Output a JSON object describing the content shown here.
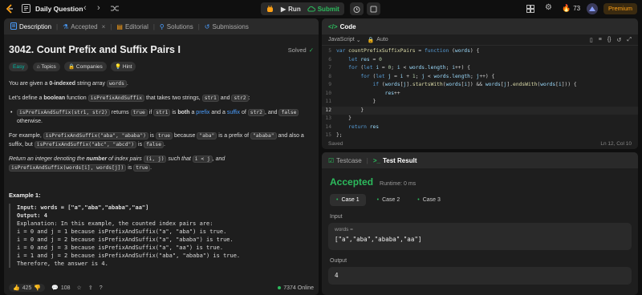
{
  "topbar": {
    "title": "Daily Question",
    "run_label": "Run",
    "submit_label": "Submit",
    "streak": "73",
    "premium_label": "Premium"
  },
  "left": {
    "tabs": [
      "Description",
      "Accepted",
      "Editorial",
      "Solutions",
      "Submissions"
    ],
    "problem_title": "3042. Count Prefix and Suffix Pairs I",
    "status": "Solved",
    "badges": [
      "Easy",
      "Topics",
      "Companies",
      "Hint"
    ],
    "desc1_a": "You are given a ",
    "desc1_b": "0-indexed",
    "desc1_c": " string array ",
    "desc1_code": "words",
    "desc1_d": ".",
    "desc2_a": "Let's define a ",
    "desc2_b": "boolean",
    "desc2_c": " function ",
    "desc2_code1": "isPrefixAndSuffix",
    "desc2_d": " that takes two strings, ",
    "desc2_code2": "str1",
    "desc2_e": " and ",
    "desc2_code3": "str2",
    "desc2_f": ":",
    "bullet_code1": "isPrefixAndSuffix(str1, str2)",
    "bullet_a": " returns ",
    "bullet_code2": "true",
    "bullet_b": " if ",
    "bullet_code3": "str1",
    "bullet_c": " is ",
    "bullet_d": "both",
    "bullet_e": " a ",
    "bullet_prefix": "prefix",
    "bullet_f": " and a ",
    "bullet_suffix": "suffix",
    "bullet_g": " of ",
    "bullet_code4": "str2",
    "bullet_h": ", and ",
    "bullet_code5": "false",
    "bullet_i": "otherwise.",
    "ex_a": "For example, ",
    "ex_code1": "isPrefixAndSuffix(\"aba\", \"ababa\")",
    "ex_b": " is ",
    "ex_code2": "true",
    "ex_c": " because ",
    "ex_code3": "\"aba\"",
    "ex_d": " is a prefix of ",
    "ex_code4": "\"ababa\"",
    "ex_e": " and also a",
    "ex_f": "suffix, but ",
    "ex_code5": "isPrefixAndSuffix(\"abc\", \"abcd\")",
    "ex_g": " is ",
    "ex_code6": "false",
    "ex_h": ".",
    "ret_a": "Return ",
    "ret_b": "an integer denoting the ",
    "ret_c": "number",
    "ret_d": " of index pairs ",
    "ret_code1": "(i, j)",
    "ret_e": " such that ",
    "ret_code2": "i < j",
    "ret_f": ", and",
    "ret_code3": "isPrefixAndSuffix(words[i], words[j])",
    "ret_g": " is ",
    "ret_code4": "true",
    "ret_h": ".",
    "example_title": "Example 1:",
    "example_lines": [
      "Input: words = [\"a\",\"aba\",\"ababa\",\"aa\"]",
      "Output: 4",
      "Explanation: In this example, the counted index pairs are:",
      "i = 0 and j = 1 because isPrefixAndSuffix(\"a\", \"aba\") is true.",
      "i = 0 and j = 2 because isPrefixAndSuffix(\"a\", \"ababa\") is true.",
      "i = 0 and j = 3 because isPrefixAndSuffix(\"a\", \"aa\") is true.",
      "i = 1 and j = 2 because isPrefixAndSuffix(\"aba\", \"ababa\") is true.",
      "Therefore, the answer is 4."
    ],
    "likes": "425",
    "comments": "108",
    "online": "7374 Online"
  },
  "code": {
    "tab_label": "Code",
    "language": "JavaScript",
    "auto_label": "Auto",
    "saved_label": "Saved",
    "cursor_pos": "Ln 12, Col 10"
  },
  "result": {
    "tab_testcase": "Testcase",
    "tab_result": "Test Result",
    "status": "Accepted",
    "runtime": "Runtime: 0 ms",
    "cases": [
      "Case 1",
      "Case 2",
      "Case 3"
    ],
    "input_label": "Input",
    "var_label": "words =",
    "input_value": "[\"a\",\"aba\",\"ababa\",\"aa\"]",
    "output_label": "Output",
    "output_value": "4"
  }
}
